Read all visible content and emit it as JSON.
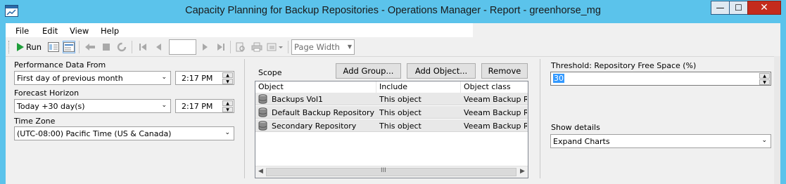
{
  "window": {
    "title": "Capacity Planning for Backup Repositories - Operations Manager - Report - greenhorse_mg",
    "controls": {
      "minimize": "—",
      "maximize": "☐",
      "close": "✕"
    }
  },
  "menu": {
    "items": [
      "File",
      "Edit",
      "View",
      "Help"
    ]
  },
  "toolbar": {
    "run_label": "Run",
    "page_number": "",
    "zoom_value": "Page Width"
  },
  "params": {
    "performance_from": {
      "label": "Performance Data From",
      "value": "First day of previous month",
      "time": "2:17 PM"
    },
    "forecast_horizon": {
      "label": "Forecast Horizon",
      "value": "Today +30 day(s)",
      "time": "2:17 PM"
    },
    "time_zone": {
      "label": "Time Zone",
      "value": "(UTC-08:00) Pacific Time (US & Canada)"
    },
    "scope": {
      "label": "Scope",
      "buttons": {
        "add_group": "Add Group...",
        "add_object": "Add Object...",
        "remove": "Remove"
      },
      "columns": [
        "Object",
        "Include",
        "Object class"
      ],
      "rows": [
        {
          "object": "Backups Vol1",
          "include": "This object",
          "class": "Veeam Backup R..."
        },
        {
          "object": "Default Backup Repository",
          "include": "This object",
          "class": "Veeam Backup R..."
        },
        {
          "object": "Secondary Repository",
          "include": "This object",
          "class": "Veeam Backup R..."
        }
      ],
      "scroll_thumb_glyph": "III"
    },
    "threshold": {
      "label": "Threshold: Repository Free Space (%)",
      "value": "30"
    },
    "show_details": {
      "label": "Show details",
      "value": "Expand Charts"
    }
  },
  "colors": {
    "titlebar": "#5bc3eb",
    "close": "#c42b1c",
    "selection": "#3399ff",
    "run_green": "#1f9e3a"
  }
}
